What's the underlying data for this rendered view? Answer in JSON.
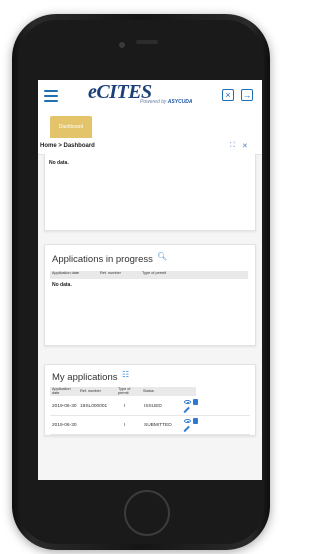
{
  "header": {
    "logo_text": "eCITES",
    "powered_text": "Powered by",
    "powered_brand": "ASYCUDA",
    "exit_icon": "close-window-icon",
    "logout_icon": "logout-icon"
  },
  "tabs": [
    {
      "label": "Dashboard"
    }
  ],
  "breadcrumb": "Home > Dashboard",
  "section_top": {
    "nodata": "No data."
  },
  "in_progress": {
    "title": "Applications in progress",
    "columns": [
      "Application date",
      "Ref. number",
      "Type of permit"
    ],
    "nodata": "No data."
  },
  "my_apps": {
    "title": "My applications",
    "columns": [
      "Application date",
      "Ref. number",
      "Type of permit",
      "Status"
    ],
    "rows": [
      {
        "date": "2019-06-30",
        "ref": "19SL000001",
        "type": "I",
        "status": "ISSUED"
      },
      {
        "date": "2019-06-30",
        "ref": "",
        "type": "I",
        "status": "SUBMITTED"
      }
    ]
  },
  "colors": {
    "accent": "#1f6fb3",
    "tab": "#e3c46a"
  }
}
